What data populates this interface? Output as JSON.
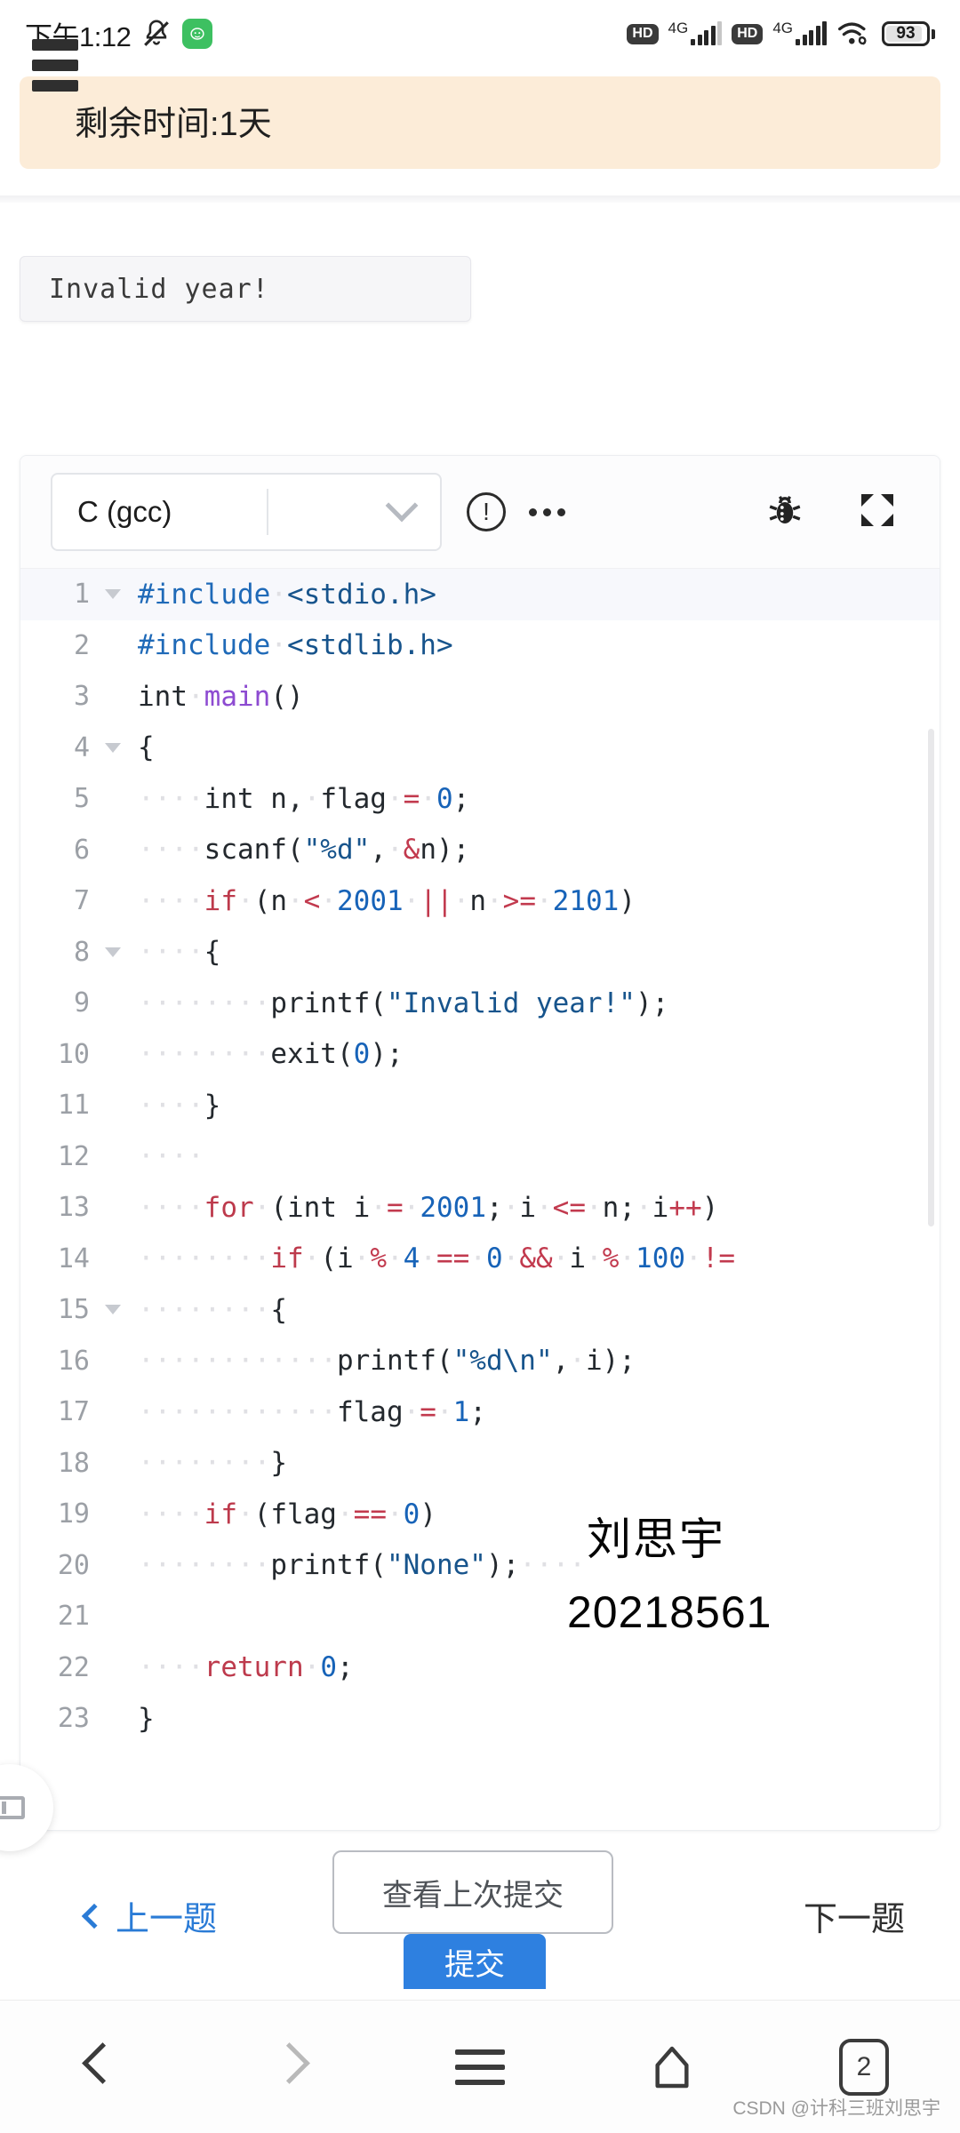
{
  "status_bar": {
    "time": "下午1:12",
    "mute_icon": "bell-muted-icon",
    "app_icon": "green-app-icon",
    "hd1": "HD",
    "net1": "4G",
    "hd2": "HD",
    "net2": "4G",
    "wifi_icon": "wifi-icon",
    "battery_level": "93"
  },
  "header": {
    "menu_icon": "hamburger-menu-icon",
    "remaining_time": "剩余时间:1天"
  },
  "output": {
    "text": "Invalid year!"
  },
  "editor": {
    "language": "C (gcc)",
    "chevron_icon": "chevron-down-icon",
    "warning_icon": "exclamation-circle-icon",
    "more_icon": "more-ellipsis-icon",
    "debug_icon": "bug-icon",
    "fullscreen_icon": "fullscreen-expand-icon",
    "lines": [
      {
        "n": "1",
        "fold": true,
        "tokens": [
          {
            "t": "pre",
            "v": "#include"
          },
          {
            "t": "ws",
            "v": "·"
          },
          {
            "t": "str",
            "v": "<stdio.h>"
          }
        ]
      },
      {
        "n": "2",
        "fold": false,
        "tokens": [
          {
            "t": "pre",
            "v": "#include"
          },
          {
            "t": "ws",
            "v": "·"
          },
          {
            "t": "str",
            "v": "<stdlib.h>"
          }
        ]
      },
      {
        "n": "3",
        "fold": false,
        "tokens": [
          {
            "t": "plain",
            "v": "int"
          },
          {
            "t": "ws",
            "v": "·"
          },
          {
            "t": "fn",
            "v": "main"
          },
          {
            "t": "plain",
            "v": "()"
          }
        ]
      },
      {
        "n": "4",
        "fold": true,
        "tokens": [
          {
            "t": "plain",
            "v": "{"
          }
        ]
      },
      {
        "n": "5",
        "fold": false,
        "tokens": [
          {
            "t": "ws",
            "v": "····"
          },
          {
            "t": "plain",
            "v": "int n,"
          },
          {
            "t": "ws",
            "v": "·"
          },
          {
            "t": "plain",
            "v": "flag"
          },
          {
            "t": "ws",
            "v": "·"
          },
          {
            "t": "op",
            "v": "="
          },
          {
            "t": "ws",
            "v": "·"
          },
          {
            "t": "num",
            "v": "0"
          },
          {
            "t": "plain",
            "v": ";"
          }
        ]
      },
      {
        "n": "6",
        "fold": false,
        "tokens": [
          {
            "t": "ws",
            "v": "····"
          },
          {
            "t": "plain",
            "v": "scanf("
          },
          {
            "t": "str",
            "v": "\"%d\""
          },
          {
            "t": "plain",
            "v": ","
          },
          {
            "t": "ws",
            "v": "·"
          },
          {
            "t": "op",
            "v": "&"
          },
          {
            "t": "plain",
            "v": "n);"
          }
        ]
      },
      {
        "n": "7",
        "fold": false,
        "tokens": [
          {
            "t": "ws",
            "v": "····"
          },
          {
            "t": "kw",
            "v": "if"
          },
          {
            "t": "ws",
            "v": "·"
          },
          {
            "t": "plain",
            "v": "(n"
          },
          {
            "t": "ws",
            "v": "·"
          },
          {
            "t": "op",
            "v": "<"
          },
          {
            "t": "ws",
            "v": "·"
          },
          {
            "t": "num",
            "v": "2001"
          },
          {
            "t": "ws",
            "v": "·"
          },
          {
            "t": "op",
            "v": "||"
          },
          {
            "t": "ws",
            "v": "·"
          },
          {
            "t": "plain",
            "v": "n"
          },
          {
            "t": "ws",
            "v": "·"
          },
          {
            "t": "op",
            "v": ">="
          },
          {
            "t": "ws",
            "v": "·"
          },
          {
            "t": "num",
            "v": "2101"
          },
          {
            "t": "plain",
            "v": ")"
          }
        ]
      },
      {
        "n": "8",
        "fold": true,
        "tokens": [
          {
            "t": "ws",
            "v": "····"
          },
          {
            "t": "plain",
            "v": "{"
          }
        ]
      },
      {
        "n": "9",
        "fold": false,
        "tokens": [
          {
            "t": "ws",
            "v": "········"
          },
          {
            "t": "plain",
            "v": "printf("
          },
          {
            "t": "str",
            "v": "\"Invalid year!\""
          },
          {
            "t": "plain",
            "v": ");"
          }
        ]
      },
      {
        "n": "10",
        "fold": false,
        "tokens": [
          {
            "t": "ws",
            "v": "········"
          },
          {
            "t": "plain",
            "v": "exit("
          },
          {
            "t": "num",
            "v": "0"
          },
          {
            "t": "plain",
            "v": ");"
          }
        ]
      },
      {
        "n": "11",
        "fold": false,
        "tokens": [
          {
            "t": "ws",
            "v": "····"
          },
          {
            "t": "plain",
            "v": "}"
          }
        ]
      },
      {
        "n": "12",
        "fold": false,
        "tokens": [
          {
            "t": "ws",
            "v": "····"
          }
        ]
      },
      {
        "n": "13",
        "fold": false,
        "tokens": [
          {
            "t": "ws",
            "v": "····"
          },
          {
            "t": "kw",
            "v": "for"
          },
          {
            "t": "ws",
            "v": "·"
          },
          {
            "t": "plain",
            "v": "(int i"
          },
          {
            "t": "ws",
            "v": "·"
          },
          {
            "t": "op",
            "v": "="
          },
          {
            "t": "ws",
            "v": "·"
          },
          {
            "t": "num",
            "v": "2001"
          },
          {
            "t": "plain",
            "v": ";"
          },
          {
            "t": "ws",
            "v": "·"
          },
          {
            "t": "plain",
            "v": "i"
          },
          {
            "t": "ws",
            "v": "·"
          },
          {
            "t": "op",
            "v": "<="
          },
          {
            "t": "ws",
            "v": "·"
          },
          {
            "t": "plain",
            "v": "n;"
          },
          {
            "t": "ws",
            "v": "·"
          },
          {
            "t": "plain",
            "v": "i"
          },
          {
            "t": "op",
            "v": "++"
          },
          {
            "t": "plain",
            "v": ")"
          }
        ]
      },
      {
        "n": "14",
        "fold": false,
        "tokens": [
          {
            "t": "ws",
            "v": "········"
          },
          {
            "t": "kw",
            "v": "if"
          },
          {
            "t": "ws",
            "v": "·"
          },
          {
            "t": "plain",
            "v": "(i"
          },
          {
            "t": "ws",
            "v": "·"
          },
          {
            "t": "op",
            "v": "%"
          },
          {
            "t": "ws",
            "v": "·"
          },
          {
            "t": "num",
            "v": "4"
          },
          {
            "t": "ws",
            "v": "·"
          },
          {
            "t": "op",
            "v": "=="
          },
          {
            "t": "ws",
            "v": "·"
          },
          {
            "t": "num",
            "v": "0"
          },
          {
            "t": "ws",
            "v": "·"
          },
          {
            "t": "op",
            "v": "&&"
          },
          {
            "t": "ws",
            "v": "·"
          },
          {
            "t": "plain",
            "v": "i"
          },
          {
            "t": "ws",
            "v": "·"
          },
          {
            "t": "op",
            "v": "%"
          },
          {
            "t": "ws",
            "v": "·"
          },
          {
            "t": "num",
            "v": "100"
          },
          {
            "t": "ws",
            "v": "·"
          },
          {
            "t": "op",
            "v": "!="
          }
        ]
      },
      {
        "n": "15",
        "fold": true,
        "tokens": [
          {
            "t": "ws",
            "v": "········"
          },
          {
            "t": "plain",
            "v": "{"
          }
        ]
      },
      {
        "n": "16",
        "fold": false,
        "tokens": [
          {
            "t": "ws",
            "v": "············"
          },
          {
            "t": "plain",
            "v": "printf("
          },
          {
            "t": "str",
            "v": "\"%d\\n\""
          },
          {
            "t": "plain",
            "v": ","
          },
          {
            "t": "ws",
            "v": "·"
          },
          {
            "t": "plain",
            "v": "i);"
          }
        ]
      },
      {
        "n": "17",
        "fold": false,
        "tokens": [
          {
            "t": "ws",
            "v": "············"
          },
          {
            "t": "plain",
            "v": "flag"
          },
          {
            "t": "ws",
            "v": "·"
          },
          {
            "t": "op",
            "v": "="
          },
          {
            "t": "ws",
            "v": "·"
          },
          {
            "t": "num",
            "v": "1"
          },
          {
            "t": "plain",
            "v": ";"
          }
        ]
      },
      {
        "n": "18",
        "fold": false,
        "tokens": [
          {
            "t": "ws",
            "v": "········"
          },
          {
            "t": "plain",
            "v": "}"
          }
        ]
      },
      {
        "n": "19",
        "fold": false,
        "tokens": [
          {
            "t": "ws",
            "v": "····"
          },
          {
            "t": "kw",
            "v": "if"
          },
          {
            "t": "ws",
            "v": "·"
          },
          {
            "t": "plain",
            "v": "(flag"
          },
          {
            "t": "ws",
            "v": "·"
          },
          {
            "t": "op",
            "v": "=="
          },
          {
            "t": "ws",
            "v": "·"
          },
          {
            "t": "num",
            "v": "0"
          },
          {
            "t": "plain",
            "v": ")"
          }
        ]
      },
      {
        "n": "20",
        "fold": false,
        "tokens": [
          {
            "t": "ws",
            "v": "········"
          },
          {
            "t": "plain",
            "v": "printf("
          },
          {
            "t": "str",
            "v": "\"None\""
          },
          {
            "t": "plain",
            "v": ");"
          },
          {
            "t": "ws",
            "v": "····"
          }
        ]
      },
      {
        "n": "21",
        "fold": false,
        "tokens": [
          {
            "t": "ws",
            "v": ""
          }
        ]
      },
      {
        "n": "22",
        "fold": false,
        "tokens": [
          {
            "t": "ws",
            "v": "····"
          },
          {
            "t": "kw",
            "v": "return"
          },
          {
            "t": "ws",
            "v": "·"
          },
          {
            "t": "num",
            "v": "0"
          },
          {
            "t": "plain",
            "v": ";"
          }
        ]
      },
      {
        "n": "23",
        "fold": false,
        "tokens": [
          {
            "t": "plain",
            "v": "}"
          }
        ]
      }
    ]
  },
  "overlay": {
    "name": "刘思宇",
    "student_id": "20218561"
  },
  "floating": {
    "icon": "panel-toggle-icon"
  },
  "actions": {
    "prev_label": "上一题",
    "last_submission_label": "查看上次提交",
    "submit_label": "提交",
    "next_label": "下一题"
  },
  "nav": {
    "back_icon": "chevron-left-icon",
    "forward_icon": "chevron-right-icon",
    "menu_icon": "menu-lines-icon",
    "home_icon": "home-icon",
    "tabs_count": "2"
  },
  "watermark": {
    "text": "CSDN @计科三班刘思宇"
  },
  "colors": {
    "banner_bg": "#fcecd8",
    "accent_blue": "#2e80e0",
    "link_blue": "#2a7bd6",
    "keyword_red": "#bd3a4c",
    "number_blue": "#1763b8",
    "string_blue": "#17548c",
    "preproc_blue": "#1f6ab8",
    "function_purple": "#8d4bd1"
  }
}
